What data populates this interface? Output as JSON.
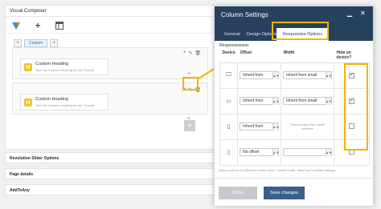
{
  "vc": {
    "title": "Visual Composer",
    "custom_tab": "Custom",
    "rows": [
      {
        "heading": "Custom Heading",
        "subtitle": "Text: My Custom Heading for this Tutorial"
      },
      {
        "heading": "Custom Heading",
        "subtitle": "Text: My Custom Heading for this Tutorial"
      }
    ]
  },
  "meta_boxes": [
    "Revolution Slider Options",
    "Page details",
    "AddToAny"
  ],
  "modal": {
    "title": "Column Settings",
    "tabs": [
      "General",
      "Design Options",
      "Responsive Options"
    ],
    "section_label": "Responsiveness",
    "columns": [
      "Device",
      "Offset",
      "Width",
      "Hide on device?"
    ],
    "rows": [
      {
        "device_icon": "desktop-icon",
        "offset": "Inherit from",
        "width": "Inherit from small",
        "hidden": true
      },
      {
        "device_icon": "tablet-landscape-icon",
        "offset": "Inherit from",
        "width": "Inherit from small",
        "hidden": true
      },
      {
        "device_icon": "tablet-portrait-icon",
        "offset": "Inherit from",
        "width_note": "Default value from width attribute",
        "hidden": false
      },
      {
        "device_icon": "phone-icon",
        "offset": "No offset",
        "width": "",
        "hidden": false
      }
    ],
    "hint": "Adjust column for different screen sizes. Control width, offset and visibility settings.",
    "close_label": "Close",
    "save_label": "Save changes"
  },
  "colors": {
    "header": "#27415c",
    "highlight": "#f5b400",
    "primary_button": "#3a5f8d"
  }
}
